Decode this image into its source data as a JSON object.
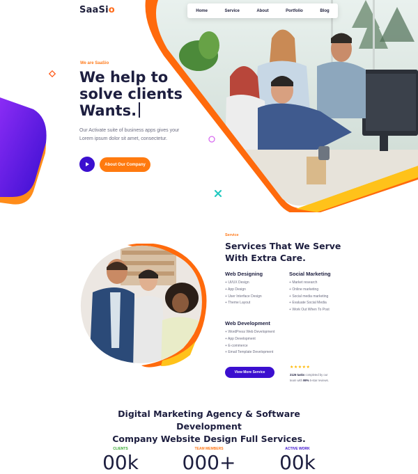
{
  "header": {
    "logo_text": "SaaSi",
    "logo_accent": "o",
    "nav": [
      "Home",
      "Service",
      "About",
      "Portfolio",
      "Blog"
    ]
  },
  "hero": {
    "eyebrow": "We are SaaSio",
    "title_lines": [
      "We help to",
      "solve clients",
      "Wants."
    ],
    "text": "Our Activate suite of business apps gives your Lorem ipsum dolor sit amet, consectetur.",
    "play_icon": "play-icon",
    "cta_label": "About Our Company"
  },
  "services": {
    "eyebrow": "Service",
    "title_lines": [
      "Services That We Serve",
      "With Extra Care."
    ],
    "columns": [
      {
        "heading": "Web Designing",
        "items": [
          "UI/UX Design",
          "App Design",
          "User Interface Design",
          "Theme Layout"
        ]
      },
      {
        "heading": "Social Marketing",
        "items": [
          "Market research",
          "Online marketing",
          "Social media marketing",
          "Evaluate Social Media",
          "Work Out When To Post"
        ]
      },
      {
        "heading": "Web Development",
        "items": [
          "WordPress Web Development",
          "App Development",
          "E-commerce",
          "Email Template Development"
        ]
      }
    ],
    "button_label": "View More Service",
    "stars": "★★★★★",
    "rating_bold1": "2126 tasks",
    "rating_text1": " completed by our",
    "rating_text2": "team with ",
    "rating_bold2": "99%",
    "rating_text3": " 5-star reviews."
  },
  "bottom": {
    "title_lines": [
      "Digital Marketing Agency & Software Development",
      "Company Website Design Full Services."
    ],
    "stats": [
      {
        "label": "CLIENTS",
        "value": "00k",
        "color": "#3aa935"
      },
      {
        "label": "TEAM MEMBERS",
        "value": "000+",
        "color": "#ff7a1a"
      },
      {
        "label": "ACTIVE WORK",
        "value": "00k",
        "color": "#3b0fcf"
      }
    ]
  },
  "colors": {
    "accent": "#ff7a0f",
    "primary": "#3b0fcf",
    "heading": "#1d1e3f"
  }
}
